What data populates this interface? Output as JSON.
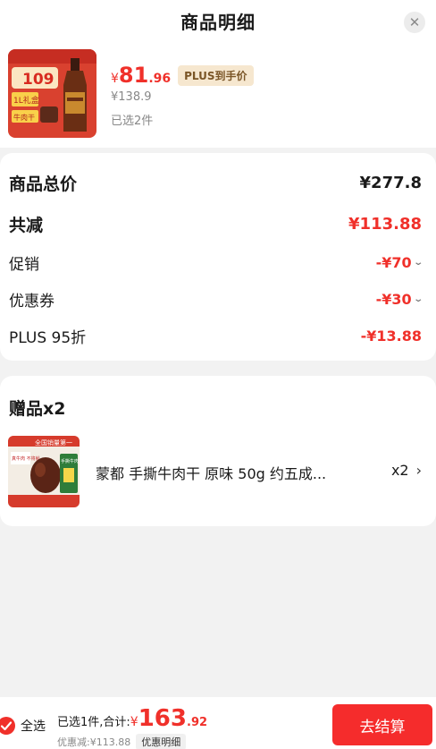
{
  "header": {
    "title": "商品明细",
    "close_icon": "close-icon"
  },
  "product": {
    "price_symbol": "¥",
    "price_int": "81",
    "price_dec": ".96",
    "plus_badge": "PLUS到手价",
    "original_price": "¥138.9",
    "selected": "已选2件",
    "thumb_text_a": "109",
    "thumb_text_b": "1L礼盒",
    "thumb_text_c": "牛肉干"
  },
  "summary": {
    "total_label": "商品总价",
    "total_value": "¥277.8",
    "discount_label": "共减",
    "discount_value": "¥113.88",
    "promo_label": "促销",
    "promo_value": "-¥70",
    "coupon_label": "优惠券",
    "coupon_value": "-¥30",
    "plus_label": "PLUS 95折",
    "plus_value": "-¥13.88"
  },
  "gifts": {
    "title": "赠品x2",
    "item_name": "蒙都 手撕牛肉干 原味 50g 约五成...",
    "item_qty": "x2",
    "thumb_text_a": "全国销量第一",
    "thumb_text_b": "真牛肉 不将就",
    "thumb_text_c": "手撕牛肉"
  },
  "footer": {
    "select_all": "全选",
    "selected_text": "已选1件,合计:",
    "total_symbol": "¥",
    "total_int": "163",
    "total_dec": ".92",
    "discount_text": "优惠减:¥113.88",
    "detail_tag": "优惠明细",
    "checkout_label": "去结算"
  },
  "colors": {
    "accent": "#f0302a",
    "plus_badge_bg": "#f6e7cf"
  }
}
